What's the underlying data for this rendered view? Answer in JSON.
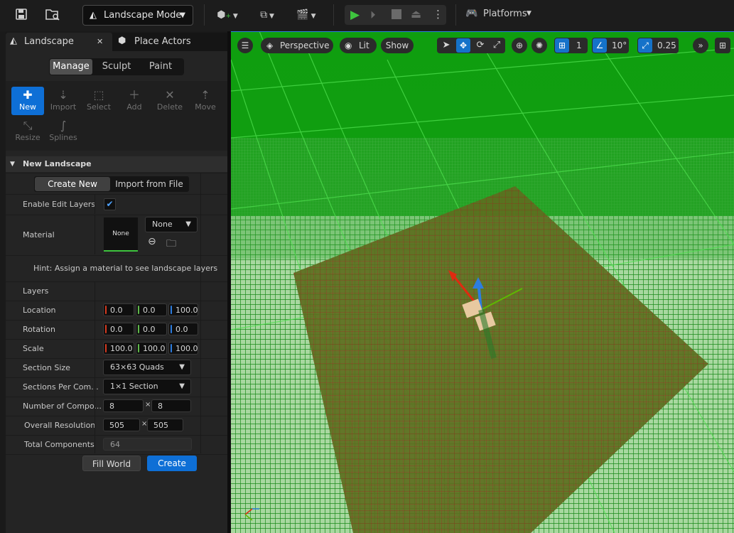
{
  "toolbar": {
    "mode_label": "Landscape Mode",
    "platforms_label": "Platforms",
    "icons": [
      "save-icon",
      "content-browser-icon",
      "add-actor-icon",
      "blueprint-icon",
      "cinematics-icon",
      "play-icon",
      "step-icon",
      "stop-icon",
      "eject-icon",
      "more-options-icon",
      "platforms-icon"
    ],
    "colors": {
      "play": "#3ec43e",
      "background": "#1c1c1c"
    }
  },
  "panel": {
    "tabs": [
      {
        "label": "Landscape",
        "close": "✕"
      },
      {
        "label": "Place Actors"
      }
    ],
    "mode_tabs": [
      "Manage",
      "Sculpt",
      "Paint"
    ],
    "active_mode_tab": "Manage",
    "tools": [
      {
        "label": "New",
        "icon": "new-landscape-icon",
        "active": true
      },
      {
        "label": "Import",
        "icon": "import-icon"
      },
      {
        "label": "Select",
        "icon": "select-icon"
      },
      {
        "label": "Add",
        "icon": "add-icon"
      },
      {
        "label": "Delete",
        "icon": "delete-icon"
      },
      {
        "label": "Move",
        "icon": "move-icon"
      },
      {
        "label": "Resize",
        "icon": "resize-icon"
      },
      {
        "label": "Splines",
        "icon": "splines-icon"
      }
    ],
    "section_title": "New Landscape",
    "create_tabs": [
      "Create New",
      "Import from File"
    ],
    "enable_edit_layers_label": "Enable Edit Layers",
    "enable_edit_layers_checked": true,
    "material_label": "Material",
    "material_thumb": "None",
    "material_value": "None",
    "hint": "Hint: Assign a material to see landscape layers",
    "layers_label": "Layers",
    "location": {
      "label": "Location",
      "x": "0.0",
      "y": "0.0",
      "z": "100.0"
    },
    "rotation": {
      "label": "Rotation",
      "x": "0.0",
      "y": "0.0",
      "z": "0.0"
    },
    "scale": {
      "label": "Scale",
      "x": "100.0",
      "y": "100.0",
      "z": "100.0"
    },
    "section_size": {
      "label": "Section Size",
      "value": "63×63 Quads"
    },
    "sections_per_component": {
      "label": "Sections Per Com...",
      "value": "1×1 Section"
    },
    "number_of_components": {
      "label": "Number of Compo...",
      "x": "8",
      "y": "8",
      "sep": "×"
    },
    "overall_resolution": {
      "label": "Overall Resolution",
      "x": "505",
      "y": "505",
      "sep": "×"
    },
    "total_components": {
      "label": "Total Components",
      "value": "64"
    },
    "fill_world_label": "Fill World",
    "create_label": "Create",
    "accent": "#0e6fd6"
  },
  "viewport": {
    "view_mode": "Perspective",
    "lighting": "Lit",
    "show_label": "Show",
    "grid_value": "1",
    "rotation_snap": "10°",
    "scale_snap": "0.25",
    "colors": {
      "floor": "#17a417",
      "landscape": "#5f6a1f"
    }
  }
}
